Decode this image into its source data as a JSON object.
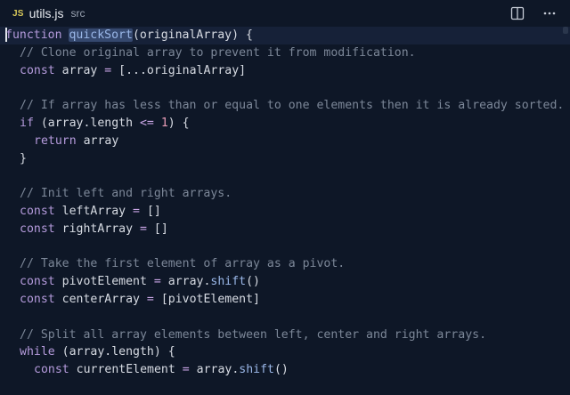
{
  "tab": {
    "icon_label": "JS",
    "file_name": "utils.js",
    "folder": "src"
  },
  "actions": [
    {
      "icon": "split-editor-icon"
    },
    {
      "icon": "more-actions-icon"
    }
  ],
  "code": {
    "l1": {
      "kw": "function",
      "fn": "quickSort",
      "rest": "(originalArray) {"
    },
    "l2": {
      "comment": "// Clone original array to prevent it from modification."
    },
    "l3": {
      "kw": "const",
      "name": " array ",
      "op": "=",
      "rest": " [...originalArray]"
    },
    "l5": {
      "comment": "// If array has less than or equal to one elements then it is already sorted."
    },
    "l6": {
      "kw": "if",
      "pre": " (array.length ",
      "op": "<=",
      "num": "1",
      "post": ") {"
    },
    "l7": {
      "kw": "return",
      "rest": " array"
    },
    "l8": {
      "rest": "}"
    },
    "l10": {
      "comment": "// Init left and right arrays."
    },
    "l11": {
      "kw": "const",
      "name": " leftArray ",
      "op": "=",
      "rest": " []"
    },
    "l12": {
      "kw": "const",
      "name": " rightArray ",
      "op": "=",
      "rest": " []"
    },
    "l14": {
      "comment": "// Take the first element of array as a pivot."
    },
    "l15": {
      "kw": "const",
      "name": " pivotElement ",
      "op": "=",
      "pre": " array.",
      "fn": "shift",
      "post": "()"
    },
    "l16": {
      "kw": "const",
      "name": " centerArray ",
      "op": "=",
      "rest": " [pivotElement]"
    },
    "l18": {
      "comment": "// Split all array elements between left, center and right arrays."
    },
    "l19": {
      "kw": "while",
      "rest": " (array.length) {"
    },
    "l20": {
      "kw": "const",
      "name": " currentElement ",
      "op": "=",
      "pre": " array.",
      "fn": "shift",
      "post": "()"
    }
  }
}
